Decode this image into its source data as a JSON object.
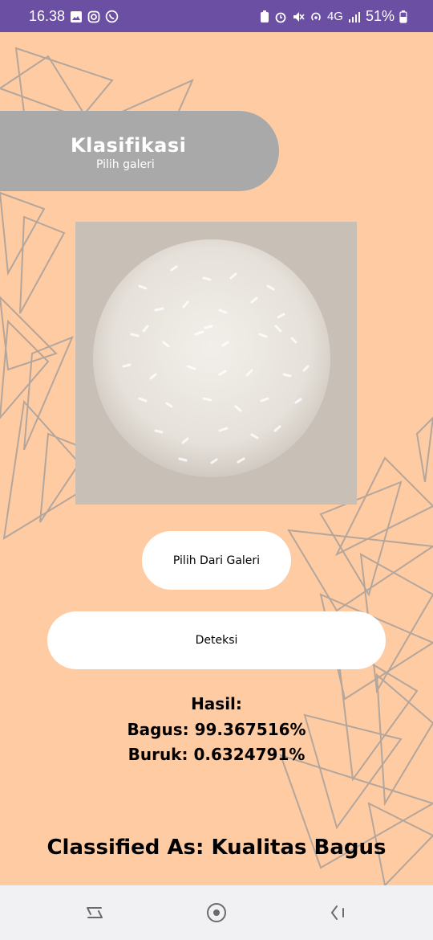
{
  "status_bar": {
    "time": "16.38",
    "network": "4G",
    "battery": "51%"
  },
  "header": {
    "title": "Klasifikasi",
    "subtitle": "Pilih galeri"
  },
  "buttons": {
    "gallery": "Pilih Dari Galeri",
    "detect": "Deteksi"
  },
  "result": {
    "heading": "Hasil:",
    "good": "Bagus: 99.367516%",
    "bad": "Buruk: 0.6324791%"
  },
  "classification": "Classified As: Kualitas Bagus",
  "colors": {
    "background": "#FFCBA3",
    "status_bar": "#6A4FA3",
    "header_pill": "#A9A9A9",
    "button": "#FFFFFF"
  }
}
